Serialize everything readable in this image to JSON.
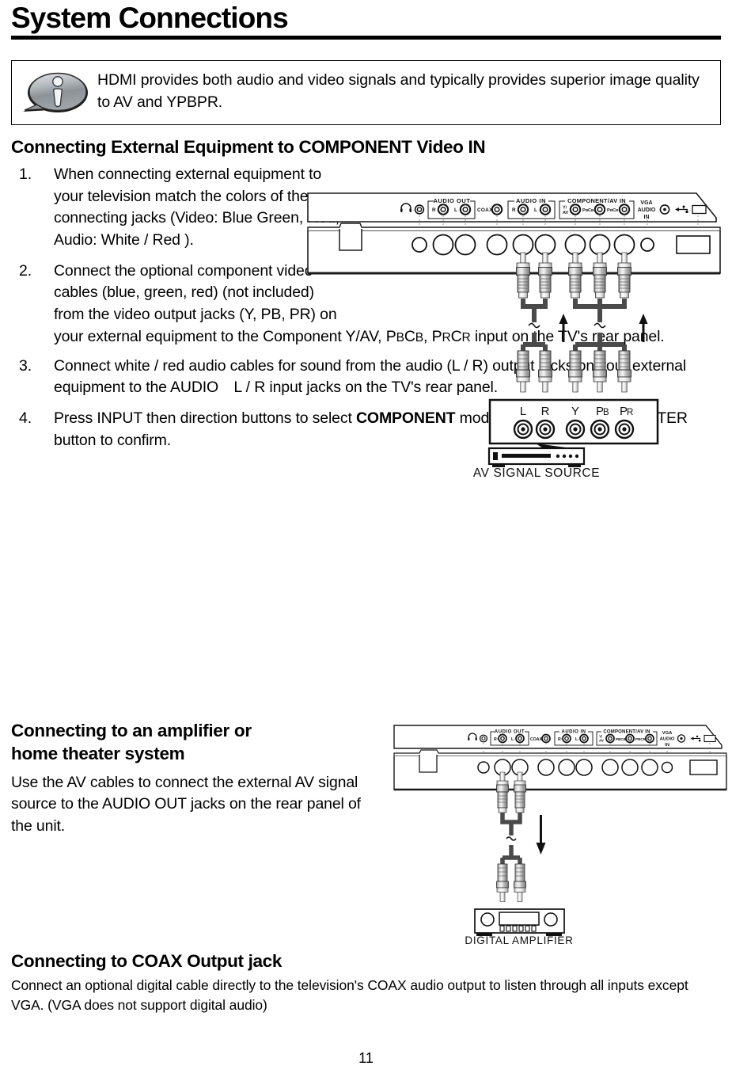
{
  "title": "System Connections",
  "note": {
    "icon": "info-bubble-icon",
    "text": "HDMI provides both audio and video signals and typically provides superior image quality to AV and YPBPR."
  },
  "section1": {
    "heading": "Connecting External Equipment to COMPONENT Video IN",
    "steps": [
      {
        "num": "1.",
        "text": "When connecting external equipment to your television match the colors of the connecting jacks (Video: Blue Green, Red; Audio: White / Red )."
      },
      {
        "num": "2.",
        "text_a": "Connect the optional component video cables (blue, green, red) (not included) from the video output jacks (Y, PB, PR) on ",
        "text_b_pre": "your external equipment to the Component Y/AV, P",
        "text_b_sc1": "B",
        "text_b_mid1": "C",
        "text_b_sc2": "B",
        "text_b_mid2": ", P",
        "text_b_sc3": "R",
        "text_b_mid3": "C",
        "text_b_sc4": "R",
        "text_b_post": " input on the TV's rear panel."
      },
      {
        "num": "3.",
        "text": "Connect white / red audio cables for sound from the audio (L / R) output jacks on your external equipment to the AUDIO L / R input jacks on the TV's rear panel."
      },
      {
        "num": "4.",
        "text_pre": "Press INPUT then direction buttons to select ",
        "text_bold": "COMPONENT",
        "text_post": " mode, and then press the ENTER button to confirm."
      }
    ]
  },
  "section2": {
    "heading_line1": "Connecting to an amplifier or",
    "heading_line2": "home theater system",
    "body": "Use the AV cables to connect the external AV signal source to the AUDIO OUT jacks on the rear panel of the unit."
  },
  "section3": {
    "heading": "Connecting to COAX Output jack",
    "body": "Connect an optional digital cable directly to the television's COAX audio output to listen through all inputs except VGA. (VGA does not support digital audio)"
  },
  "diagram_component": {
    "caption": "AV SIGNAL SOURCE",
    "panel_groups": [
      {
        "name": "AUDIO OUT",
        "ports": [
          "R",
          "L"
        ]
      },
      {
        "name": "AUDIO IN",
        "ports": [
          "R",
          "L"
        ]
      },
      {
        "name": "COMPONENT/AV IN",
        "ports": [
          "Y/AV",
          "PB/CB",
          "PR/CR"
        ]
      }
    ],
    "panel_single_labels": [
      "COAX",
      "VGA AUDIO IN"
    ],
    "headphone_icon": "headphone-icon",
    "usb_icon": "usb-icon",
    "source_jacks": [
      "L",
      "R",
      "Y",
      "PB",
      "PR"
    ]
  },
  "diagram_amplifier": {
    "caption": "DIGITAL AMPLIFIER",
    "panel_groups": [
      {
        "name": "AUDIO OUT",
        "ports": [
          "R",
          "L"
        ]
      },
      {
        "name": "AUDIO IN",
        "ports": [
          "R",
          "L"
        ]
      },
      {
        "name": "COMPONENT/AV IN",
        "ports": [
          "Y/AV",
          "PB/CB",
          "PR/CR"
        ]
      }
    ],
    "panel_single_labels": [
      "COAX",
      "VGA AUDIO IN"
    ]
  },
  "page_number": "11",
  "colors": {
    "text": "#000000",
    "icon_gray_light": "#c8ccd0",
    "icon_gray_dark": "#6f7479",
    "cable_gray": "#4a4a4a",
    "connector_light": "#e8e8e8",
    "connector_mid": "#9a9a9a"
  }
}
